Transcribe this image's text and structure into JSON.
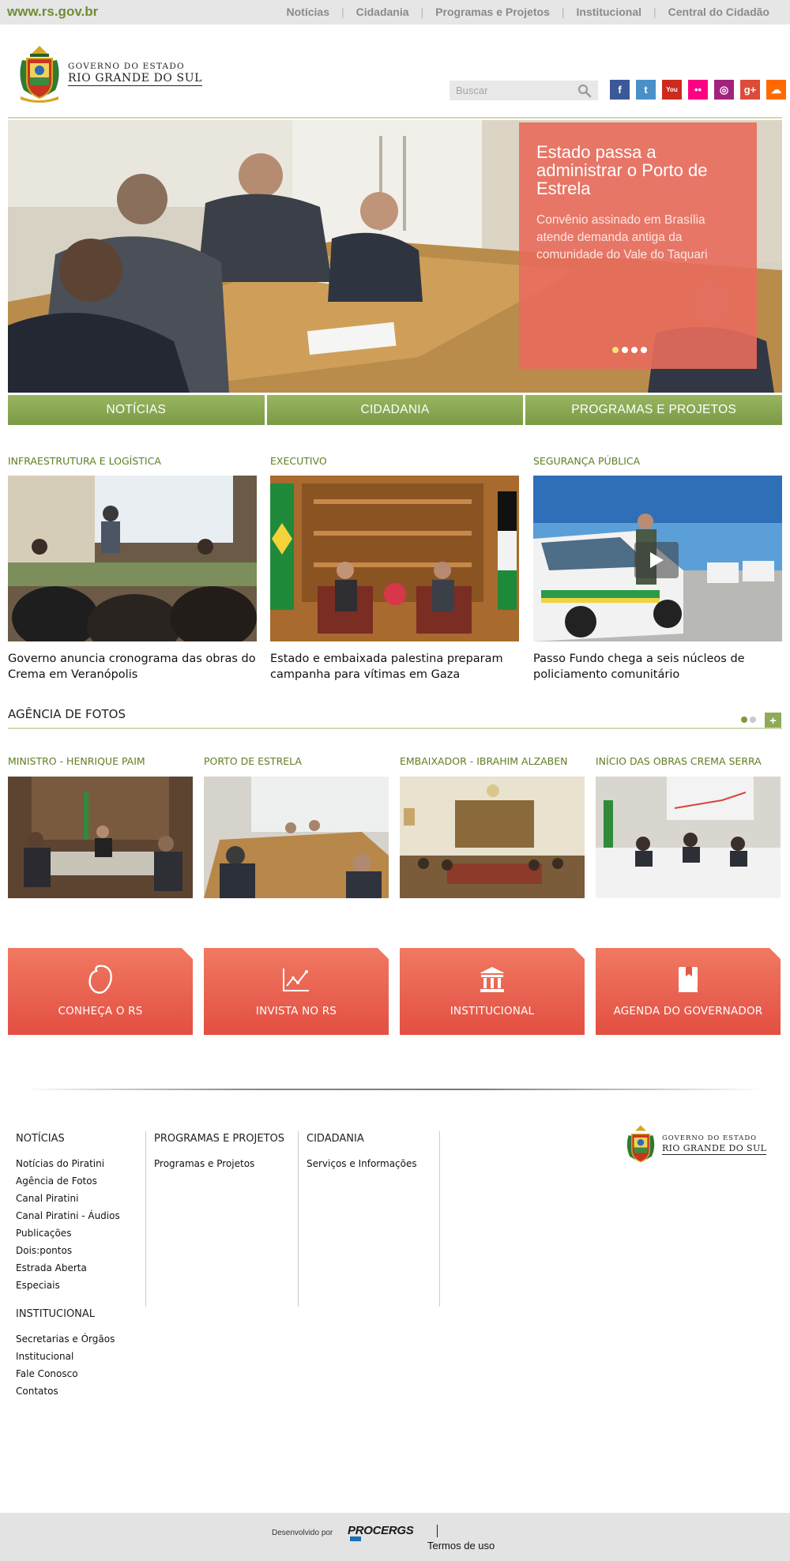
{
  "topbar": {
    "site_url": "www.rs.gov.br",
    "nav": [
      "Notícias",
      "Cidadania",
      "Programas e Projetos",
      "Institucional",
      "Central do Cidadão"
    ]
  },
  "header": {
    "logo_line1": "GOVERNO DO ESTADO",
    "logo_line2": "RIO GRANDE DO SUL",
    "search_placeholder": "Buscar",
    "social": [
      {
        "name": "facebook",
        "glyph": "f",
        "color": "#3b5998"
      },
      {
        "name": "twitter",
        "glyph": "t",
        "color": "#4a90c8"
      },
      {
        "name": "youtube",
        "glyph": "You",
        "color": "#cc2a1e"
      },
      {
        "name": "flickr",
        "glyph": "••",
        "color": "#ff0084"
      },
      {
        "name": "instagram",
        "glyph": "◎",
        "color": "#a2237b"
      },
      {
        "name": "google-plus",
        "glyph": "g+",
        "color": "#dd4b39"
      },
      {
        "name": "soundcloud",
        "glyph": "☁",
        "color": "#ff6a00"
      }
    ]
  },
  "hero": {
    "title": "Estado passa a administrar o Porto de Estrela",
    "subtitle": "Convênio assinado em Brasília atende demanda antiga da comunidade do Vale do Taquari",
    "slides": 4,
    "active_slide": 1
  },
  "categories": [
    "NOTÍCIAS",
    "CIDADANIA",
    "PROGRAMAS E PROJETOS"
  ],
  "news": [
    {
      "category": "INFRAESTRUTURA E LOGÍSTICA",
      "title": "Governo anuncia cronograma das obras do Crema em Veranópolis"
    },
    {
      "category": "EXECUTIVO",
      "title": "Estado e embaixada palestina preparam campanha para vítimas em Gaza"
    },
    {
      "category": "SEGURANÇA PÚBLICA",
      "title": "Passo Fundo chega a seis núcleos de policiamento comunitário"
    }
  ],
  "agency": {
    "title": "AGÊNCIA DE FOTOS",
    "more": "+",
    "photos": [
      {
        "caption": "MINISTRO - HENRIQUE PAIM"
      },
      {
        "caption": "PORTO DE ESTRELA"
      },
      {
        "caption": "EMBAIXADOR - IBRAHIM ALZABEN"
      },
      {
        "caption": "INÍCIO DAS OBRAS CREMA SERRA"
      }
    ]
  },
  "cards": [
    {
      "label": "CONHEÇA O RS",
      "icon": "rs-map-icon"
    },
    {
      "label": "INVISTA NO RS",
      "icon": "growth-chart-icon"
    },
    {
      "label": "INSTITUCIONAL",
      "icon": "government-building-icon"
    },
    {
      "label": "AGENDA DO GOVERNADOR",
      "icon": "agenda-book-icon"
    }
  ],
  "footer": {
    "noticias": {
      "heading": "NOTÍCIAS",
      "links": [
        "Notícias do Piratini",
        "Agência de Fotos",
        "Canal Piratini",
        "Canal Piratini - Áudios",
        "Publicações",
        "Dois:pontos",
        "Estrada Aberta",
        "Especiais"
      ]
    },
    "institucional": {
      "heading": "INSTITUCIONAL",
      "links": [
        "Secretarias e Órgãos",
        "Institucional",
        "Fale Conosco",
        "Contatos"
      ]
    },
    "programas": {
      "heading": "PROGRAMAS E PROJETOS",
      "links": [
        "Programas e Projetos"
      ]
    },
    "cidadania": {
      "heading": "CIDADANIA",
      "links": [
        "Serviços e Informações"
      ]
    },
    "logo_line1": "GOVERNO DO ESTADO",
    "logo_line2": "RIO GRANDE DO SUL"
  },
  "bottom": {
    "developed_by": "Desenvolvido por",
    "developer": "PROCERGS",
    "terms": "Termos de uso"
  }
}
